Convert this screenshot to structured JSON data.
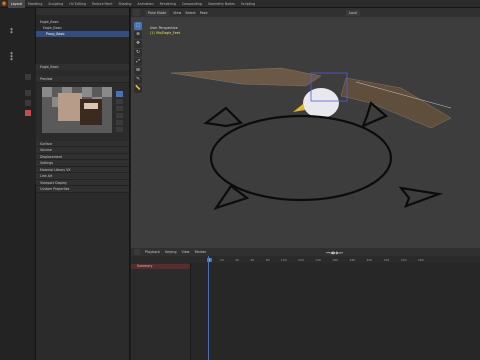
{
  "app": {
    "logo": "blender-logo"
  },
  "topbar": {
    "tabs": [
      "Layout",
      "Modeling",
      "Sculpting",
      "UV Editing",
      "Texture Paint",
      "Shading",
      "Animation",
      "Rendering",
      "Compositing",
      "Geometry Nodes",
      "Scripting"
    ],
    "active_tab": "Layout"
  },
  "outliner": {
    "search_placeholder": "",
    "rows": [
      {
        "label": "Eagle_Basic",
        "selected": false
      },
      {
        "label": "Eagle_Basic",
        "selected": false
      },
      {
        "label": "Proxy_Basic",
        "selected": true
      }
    ]
  },
  "properties": {
    "material_name": "Eagle_Basic",
    "preview_label": "Preview",
    "panels": [
      "Surface",
      "Volume",
      "Displacement",
      "Settings",
      "Material Library VX",
      "Line Art",
      "Viewport Display",
      "Custom Properties"
    ]
  },
  "viewport": {
    "mode": "Pose Mode",
    "menus": [
      "View",
      "Select",
      "Pose"
    ],
    "overlay_title": "User Perspective",
    "overlay_subtitle": "(1) Vfx/Eagle_Feet",
    "transform_orientation": "Local"
  },
  "toolbar": {
    "tools": [
      "select-icon",
      "cursor-icon",
      "move-icon",
      "rotate-icon",
      "scale-icon",
      "transform-icon",
      "annotate-icon",
      "measure-icon"
    ]
  },
  "timeline": {
    "menus": [
      "Playback",
      "Keying",
      "View",
      "Marker"
    ],
    "current_frame": "1",
    "ruler_ticks": [
      "0",
      "20",
      "40",
      "60",
      "80",
      "100",
      "120",
      "140",
      "160",
      "180",
      "200",
      "220",
      "240",
      "260"
    ],
    "channel": "Summary"
  },
  "colors": {
    "accent": "#4772b3",
    "selection": "#334d80",
    "logo": "#e87d0d"
  }
}
